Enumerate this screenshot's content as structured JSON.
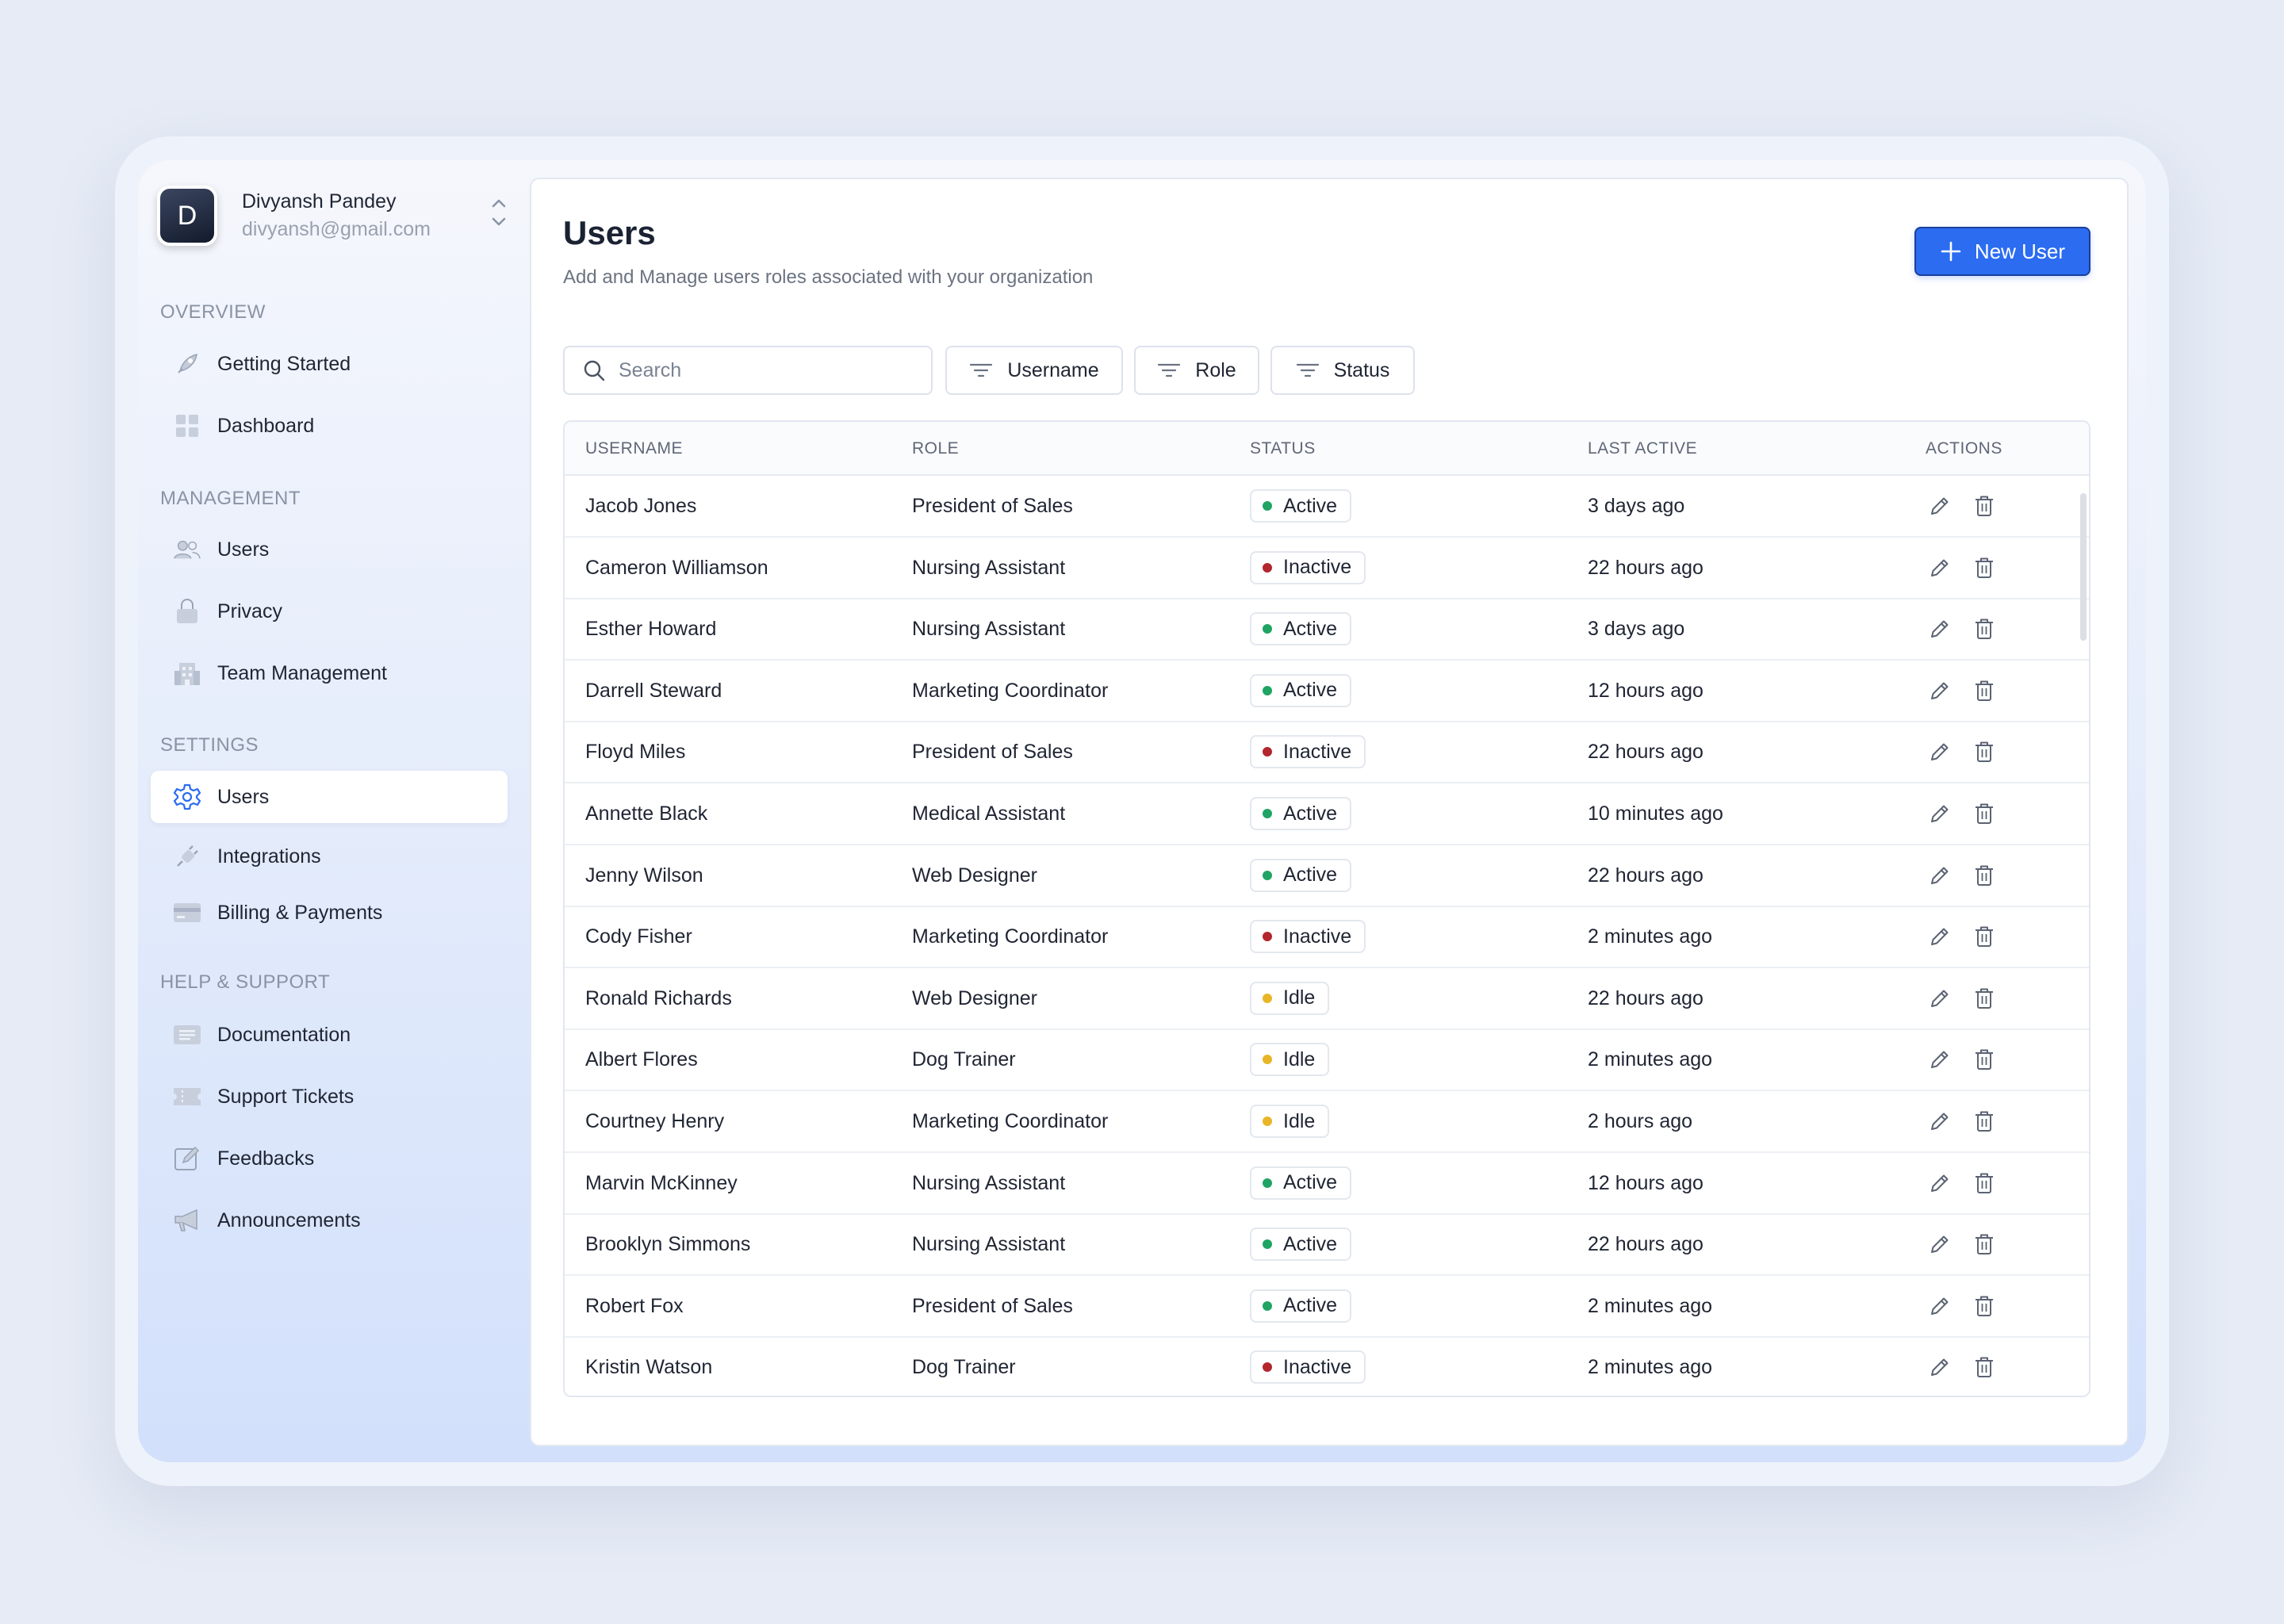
{
  "account": {
    "initial": "D",
    "name": "Divyansh Pandey",
    "email": "divyansh@gmail.com"
  },
  "sidebar": {
    "sections": [
      {
        "label": "OVERVIEW",
        "items": [
          {
            "label": "Getting Started",
            "icon": "rocket-icon"
          },
          {
            "label": "Dashboard",
            "icon": "grid-icon"
          }
        ]
      },
      {
        "label": "MANAGEMENT",
        "items": [
          {
            "label": "Users",
            "icon": "users-icon"
          },
          {
            "label": "Privacy",
            "icon": "lock-icon"
          },
          {
            "label": "Team Management",
            "icon": "building-icon"
          }
        ]
      },
      {
        "label": "SETTINGS",
        "items": [
          {
            "label": "Users",
            "icon": "gear-icon",
            "active": true
          },
          {
            "label": "Integrations",
            "icon": "plug-icon"
          },
          {
            "label": "Billing & Payments",
            "icon": "credit-card-icon"
          }
        ]
      },
      {
        "label": "HELP & SUPPORT",
        "items": [
          {
            "label": "Documentation",
            "icon": "document-icon"
          },
          {
            "label": "Support Tickets",
            "icon": "ticket-icon"
          },
          {
            "label": "Feedbacks",
            "icon": "edit-icon"
          },
          {
            "label": "Announcements",
            "icon": "megaphone-icon"
          }
        ]
      }
    ]
  },
  "header": {
    "title": "Users",
    "subtitle": "Add and Manage users roles associated with your organization",
    "new_user_label": "New User"
  },
  "filters": {
    "search_placeholder": "Search",
    "username_label": "Username",
    "role_label": "Role",
    "status_label": "Status"
  },
  "table": {
    "columns": [
      "USERNAME",
      "ROLE",
      "STATUS",
      "LAST ACTIVE",
      "ACTIONS"
    ],
    "rows": [
      {
        "username": "Jacob Jones",
        "role": "President of Sales",
        "status": "Active",
        "last_active": "3 days ago"
      },
      {
        "username": "Cameron Williamson",
        "role": "Nursing Assistant",
        "status": "Inactive",
        "last_active": "22 hours ago"
      },
      {
        "username": "Esther Howard",
        "role": "Nursing Assistant",
        "status": "Active",
        "last_active": "3 days ago"
      },
      {
        "username": "Darrell Steward",
        "role": "Marketing Coordinator",
        "status": "Active",
        "last_active": "12 hours ago"
      },
      {
        "username": "Floyd Miles",
        "role": "President of Sales",
        "status": "Inactive",
        "last_active": "22 hours ago"
      },
      {
        "username": "Annette Black",
        "role": "Medical Assistant",
        "status": "Active",
        "last_active": "10 minutes ago"
      },
      {
        "username": "Jenny Wilson",
        "role": "Web Designer",
        "status": "Active",
        "last_active": "22 hours ago"
      },
      {
        "username": "Cody Fisher",
        "role": "Marketing Coordinator",
        "status": "Inactive",
        "last_active": "2 minutes ago"
      },
      {
        "username": "Ronald Richards",
        "role": "Web Designer",
        "status": "Idle",
        "last_active": "22 hours ago"
      },
      {
        "username": "Albert Flores",
        "role": "Dog Trainer",
        "status": "Idle",
        "last_active": "2 minutes ago"
      },
      {
        "username": "Courtney Henry",
        "role": "Marketing Coordinator",
        "status": "Idle",
        "last_active": "2 hours ago"
      },
      {
        "username": "Marvin McKinney",
        "role": "Nursing Assistant",
        "status": "Active",
        "last_active": "12 hours ago"
      },
      {
        "username": "Brooklyn Simmons",
        "role": "Nursing Assistant",
        "status": "Active",
        "last_active": "22 hours ago"
      },
      {
        "username": "Robert Fox",
        "role": "President of Sales",
        "status": "Active",
        "last_active": "2 minutes ago"
      },
      {
        "username": "Kristin Watson",
        "role": "Dog Trainer",
        "status": "Inactive",
        "last_active": "2 minutes ago"
      }
    ]
  },
  "colors": {
    "accent": "#2b6cf0",
    "status_active": "#1fa463",
    "status_inactive": "#b3262d",
    "status_idle": "#e8b528"
  }
}
